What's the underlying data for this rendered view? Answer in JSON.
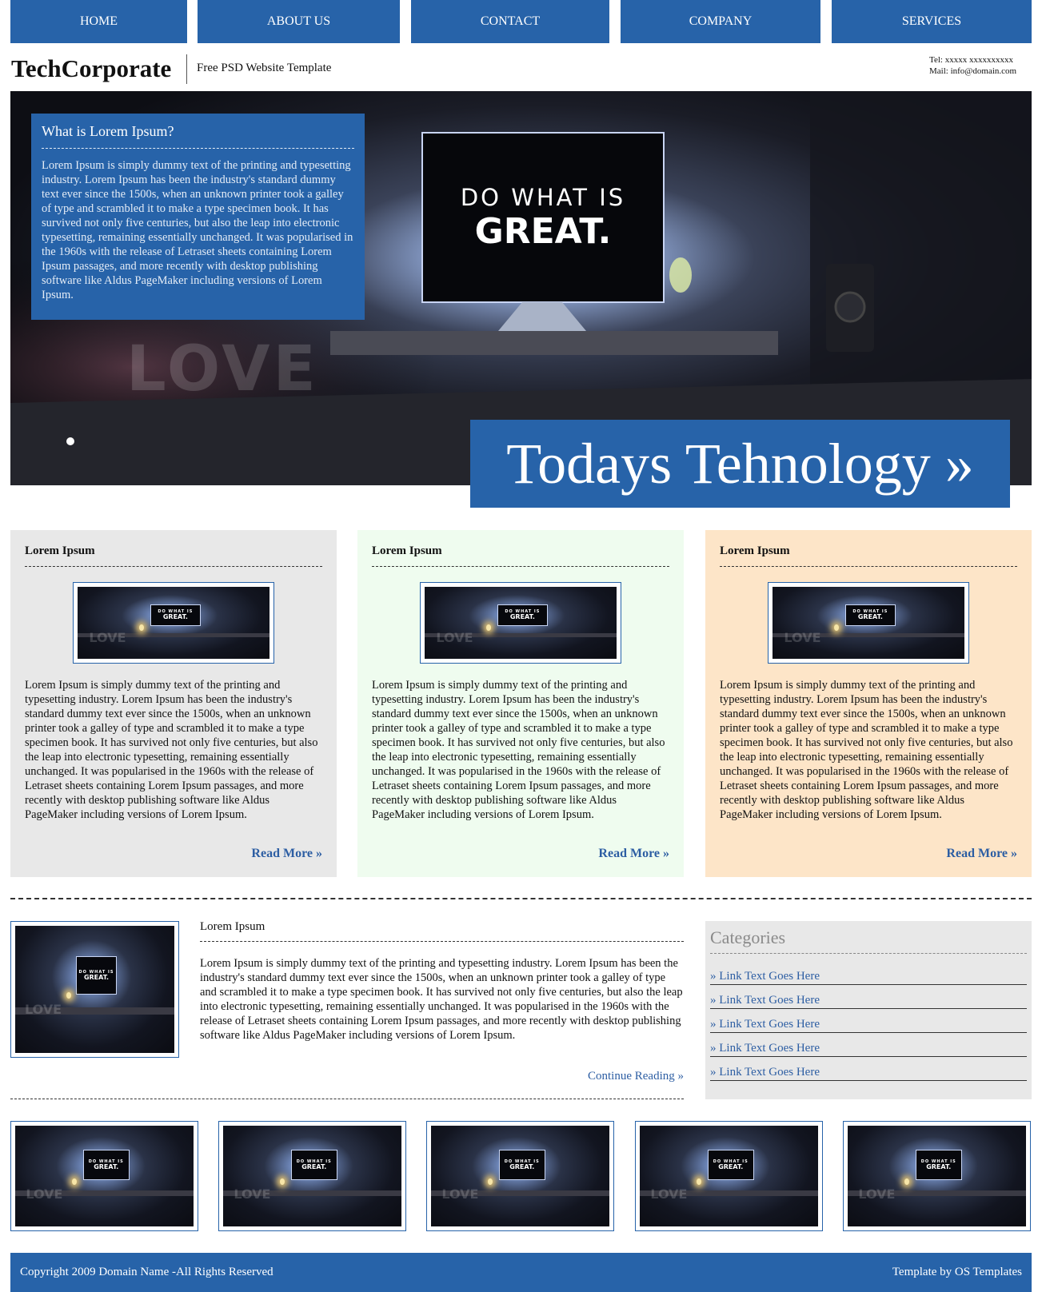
{
  "nav": [
    {
      "label": "HOME"
    },
    {
      "label": "ABOUT US"
    },
    {
      "label": "CONTACT"
    },
    {
      "label": "COMPANY"
    },
    {
      "label": "SERVICES"
    }
  ],
  "header": {
    "logo": "TechCorporate",
    "tagline": "Free PSD Website Template",
    "tel": "Tel: xxxxx xxxxxxxxxx",
    "mail": "Mail: info@domain.com"
  },
  "hero": {
    "box_title": "What is Lorem Ipsum?",
    "box_text": "Lorem Ipsum is simply dummy text of the printing and typesetting industry. Lorem Ipsum has been the industry's standard dummy text ever since the 1500s, when an unknown printer took a galley of type and scrambled it to make a type specimen book. It has survived not only five centuries, but also the leap into electronic typesetting, remaining essentially unchanged. It was popularised in the 1960s with the release of Letraset sheets containing Lorem Ipsum passages, and more recently with desktop publishing software like Aldus PageMaker including versions of Lorem Ipsum.",
    "banner": "Todays Tehnology »",
    "monitor_line1": "DO WHAT IS",
    "monitor_line2": "GREAT.",
    "love_text": "LOVE"
  },
  "features": [
    {
      "title": "Lorem Ipsum",
      "bg": "#e8e8e8",
      "text": "Lorem Ipsum is simply dummy text of the printing and typesetting industry. Lorem Ipsum has been the industry's standard dummy text ever since the 1500s, when an unknown printer took a galley of type and scrambled it to make a type specimen book. It has survived not only five centuries, but also the leap into electronic typesetting, remaining essentially unchanged. It was popularised in the 1960s with the release of Letraset sheets containing Lorem Ipsum passages, and more recently with desktop publishing software like Aldus PageMaker including versions of Lorem Ipsum.",
      "more": "Read More »"
    },
    {
      "title": "Lorem Ipsum",
      "bg": "#effcef",
      "text": "Lorem Ipsum is simply dummy text of the printing and typesetting industry. Lorem Ipsum has been the industry's standard dummy text ever since the 1500s, when an unknown printer took a galley of type and scrambled it to make a type specimen book. It has survived not only five centuries, but also the leap into electronic typesetting, remaining essentially unchanged. It was popularised in the 1960s with the release of Letraset sheets containing Lorem Ipsum passages, and more recently with desktop publishing software like Aldus PageMaker including versions of Lorem Ipsum.",
      "more": "Read More »"
    },
    {
      "title": "Lorem Ipsum",
      "bg": "#fde5c8",
      "text": "Lorem Ipsum is simply dummy text of the printing and typesetting industry. Lorem Ipsum has been the industry's standard dummy text ever since the 1500s, when an unknown printer took a galley of type and scrambled it to make a type specimen book. It has survived not only five centuries, but also the leap into electronic typesetting, remaining essentially unchanged. It was popularised in the 1960s with the release of Letraset sheets containing Lorem Ipsum passages, and more recently with desktop publishing software like Aldus PageMaker including versions of Lorem Ipsum.",
      "more": "Read More »"
    }
  ],
  "article": {
    "title": "Lorem Ipsum",
    "text": "Lorem Ipsum is simply dummy text of the printing and typesetting industry. Lorem Ipsum has been the industry's standard dummy text ever since the 1500s, when an unknown printer took a galley of type and scrambled it to make a type specimen book. It has survived not only five centuries, but also the leap into electronic typesetting, remaining essentially unchanged. It was popularised in the 1960s with the release of Letraset sheets containing Lorem Ipsum passages, and more recently with desktop publishing software like Aldus PageMaker including versions of Lorem Ipsum.",
    "more": "Continue Reading »"
  },
  "sidebar": {
    "title": "Categories",
    "links": [
      "» Link Text Goes Here",
      "» Link Text Goes Here",
      "» Link Text Goes Here",
      "» Link Text Goes Here",
      "» Link Text Goes Here"
    ]
  },
  "gallery": [
    {
      "icon": "desk-photo"
    },
    {
      "icon": "desk-photo"
    },
    {
      "icon": "desk-photo"
    },
    {
      "icon": "desk-photo"
    },
    {
      "icon": "desk-photo"
    }
  ],
  "footer": {
    "copyright": "Copyright 2009 Domain Name -All Rights Reserved",
    "credit": "Template by OS Templates"
  },
  "colors": {
    "accent": "#2763a9",
    "link": "#2d5ea3"
  }
}
